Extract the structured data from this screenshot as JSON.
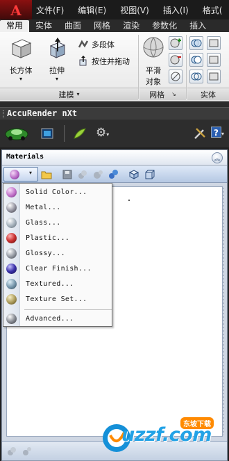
{
  "menubar": {
    "items": [
      "文件(F)",
      "编辑(E)",
      "视图(V)",
      "插入(I)",
      "格式("
    ]
  },
  "ribbon_tabs": [
    "常用",
    "实体",
    "曲面",
    "网格",
    "渲染",
    "参数化",
    "插入"
  ],
  "ribbon": {
    "box_label": "长方体",
    "extrude_label": "拉伸",
    "polysolid_label": "多段体",
    "presspull_label": "按住并拖动",
    "smooth_label_line1": "平滑",
    "smooth_label_line2": "对象",
    "panel_modeling": "建模",
    "panel_mesh": "网格",
    "panel_solid_edit": "实体"
  },
  "accurender": {
    "title": "AccuRender nXt"
  },
  "materials": {
    "title": "Materials"
  },
  "dropdown": {
    "items": [
      {
        "label": "Solid Color...",
        "color": "#c070c8"
      },
      {
        "label": "Metal...",
        "color": "#9a9aa6"
      },
      {
        "label": "Glass...",
        "color": "#a8b4be"
      },
      {
        "label": "Plastic...",
        "color": "#c83030"
      },
      {
        "label": "Glossy...",
        "color": "#9a9fa8"
      },
      {
        "label": "Clear Finish...",
        "color": "#3a30a8"
      },
      {
        "label": "Textured...",
        "color": "#7a9ab0"
      },
      {
        "label": "Texture Set...",
        "color": "#b0a060"
      },
      {
        "label": "Advanced...",
        "color": "#8a8e96"
      }
    ]
  },
  "watermark": {
    "text": "uzzf.com",
    "badge": "东坡下载"
  }
}
